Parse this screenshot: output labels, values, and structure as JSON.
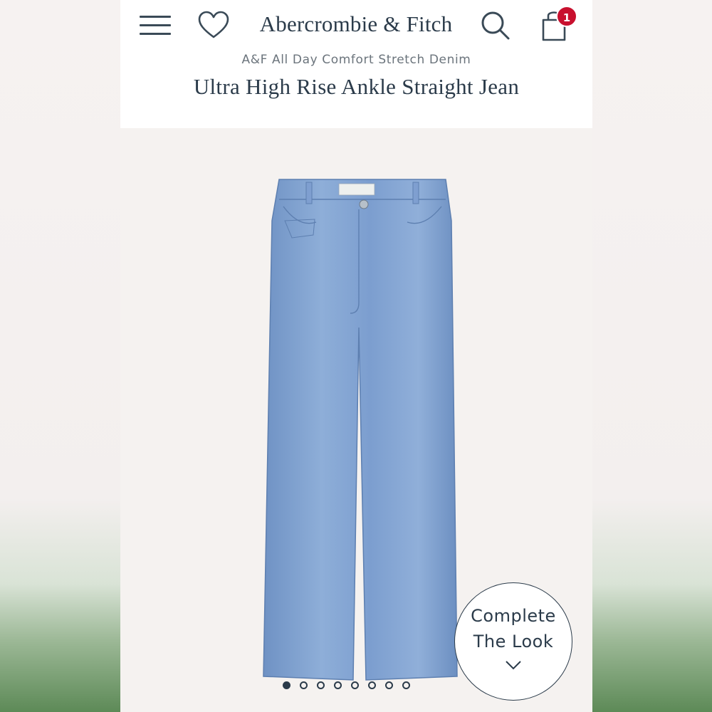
{
  "brand": {
    "logo_text": "Abercrombie & Fitch"
  },
  "header": {
    "cart_count": "1",
    "icons": [
      "menu-icon",
      "heart-icon",
      "search-icon",
      "shopping-bag-icon"
    ]
  },
  "product": {
    "collection": "A&F All Day Comfort Stretch Denim",
    "name": "Ultra High Rise Ankle Straight Jean"
  },
  "carousel": {
    "total": 8,
    "active_index": 0
  },
  "complete_look": {
    "line1": "Complete",
    "line2": "The Look"
  },
  "colors": {
    "brand_navy": "#2b3b4a",
    "badge_red": "#c8102e",
    "denim": "#7ea0d0"
  }
}
